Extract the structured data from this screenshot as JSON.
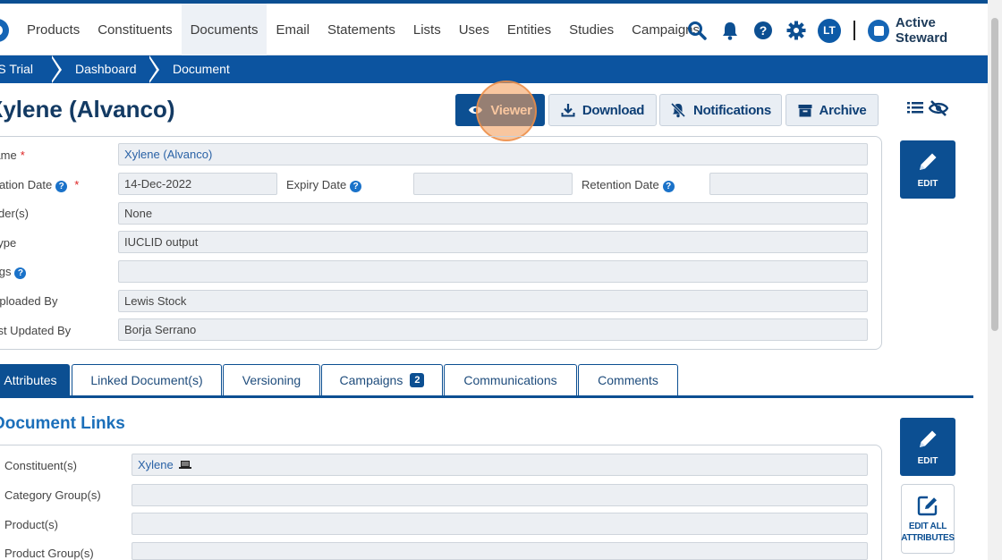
{
  "nav": {
    "items": [
      "Products",
      "Constituents",
      "Documents",
      "Email",
      "Statements",
      "Lists",
      "Uses",
      "Entities",
      "Studies",
      "Campaigns"
    ],
    "active": "Documents",
    "user_initials": "LT",
    "brand": "Active Steward"
  },
  "breadcrumb": [
    "AS Trial",
    "Dashboard",
    "Document"
  ],
  "document": {
    "title": "Xylene (Alvanco)"
  },
  "actions": {
    "viewer": "Viewer",
    "download": "Download",
    "notifications": "Notifications",
    "archive": "Archive"
  },
  "fields": {
    "name_label": "Name",
    "name_value": "Xylene (Alvanco)",
    "creation_label": "Creation Date",
    "creation_value": "14-Dec-2022",
    "expiry_label": "Expiry Date",
    "expiry_value": "",
    "retention_label": "Retention Date",
    "retention_value": "",
    "folder_label": "Folder(s)",
    "folder_value": "None",
    "type_label": "Type",
    "type_value": "IUCLID output",
    "tags_label": "Tags",
    "tags_value": "",
    "uploaded_label": "Uploaded By",
    "uploaded_value": "Lewis Stock",
    "updated_label": "Last Updated By",
    "updated_value": "Borja Serrano"
  },
  "edit_label": "EDIT",
  "edit_all_label": "EDIT ALL ATTRIBUTES",
  "tabs": [
    {
      "label": "Attributes",
      "active": true
    },
    {
      "label": "Linked Document(s)"
    },
    {
      "label": "Versioning"
    },
    {
      "label": "Campaigns",
      "badge": "2"
    },
    {
      "label": "Communications"
    },
    {
      "label": "Comments"
    }
  ],
  "links": {
    "section_title": "Document Links",
    "constituent_label": "Constituent(s)",
    "constituent_value": "Xylene",
    "category_label": "Category Group(s)",
    "category_value": "",
    "product_label": "Product(s)",
    "product_value": "",
    "product_group_label": "Product Group(s)",
    "product_group_value": ""
  },
  "colors": {
    "primary": "#0c4f92",
    "link": "#1b6fba",
    "highlight": "#f3a05f"
  }
}
